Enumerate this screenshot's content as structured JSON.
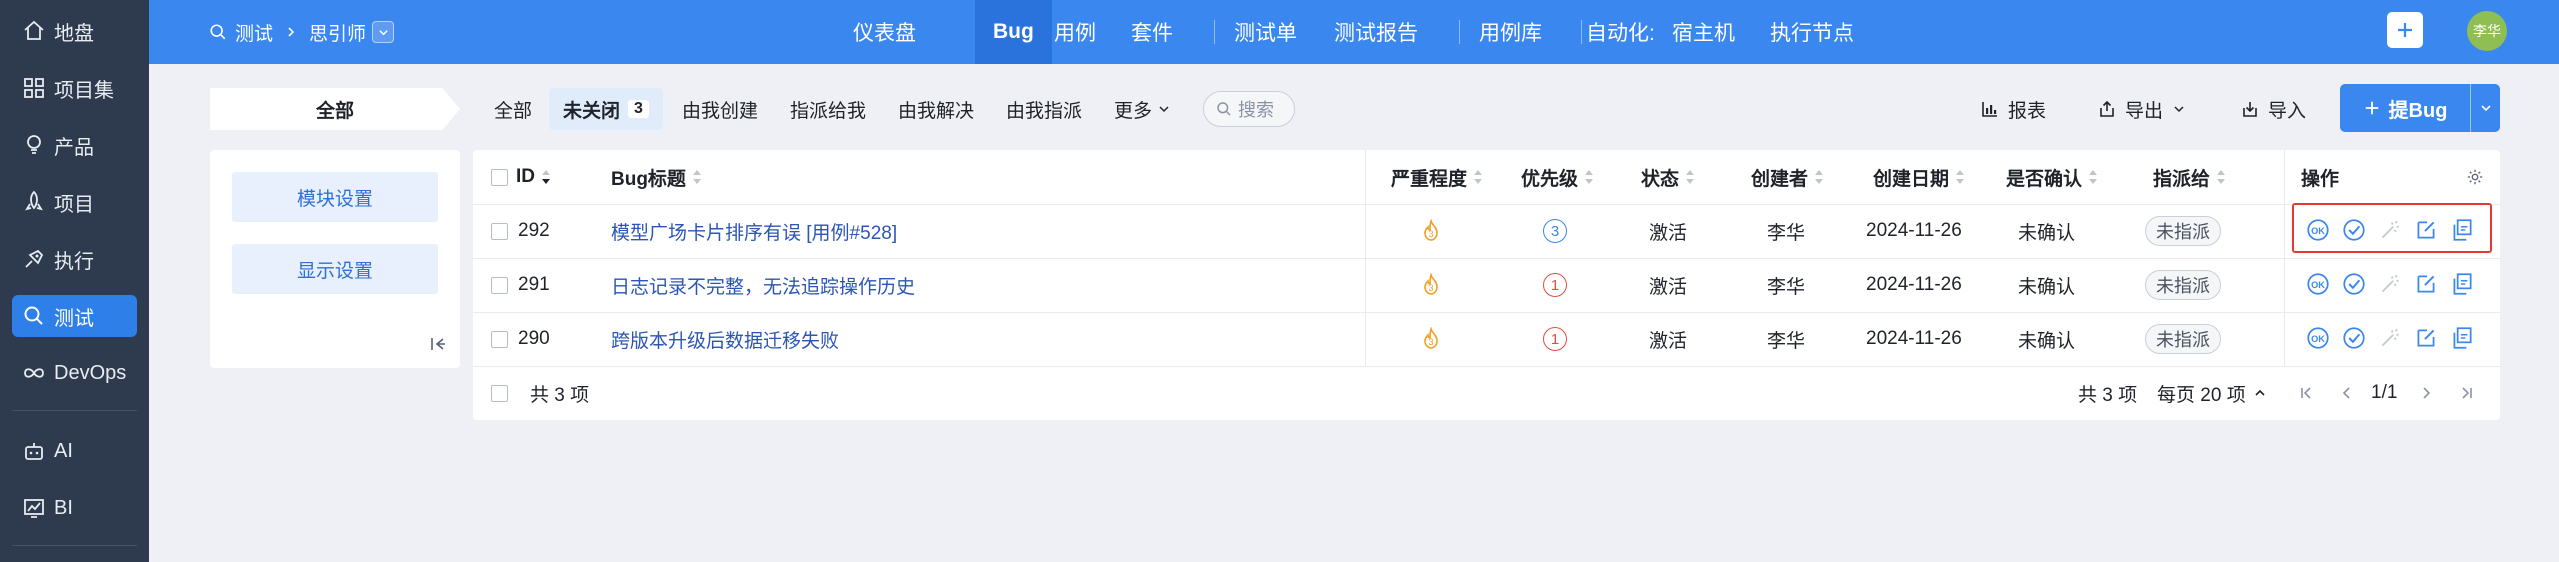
{
  "sidebar": {
    "items": [
      {
        "label": "地盘",
        "icon": "home-icon"
      },
      {
        "label": "项目集",
        "icon": "grid-icon"
      },
      {
        "label": "产品",
        "icon": "bulb-icon"
      },
      {
        "label": "项目",
        "icon": "rocket-icon"
      },
      {
        "label": "执行",
        "icon": "run-icon"
      },
      {
        "label": "测试",
        "icon": "search-icon"
      },
      {
        "label": "DevOps",
        "icon": "infinity-icon"
      },
      {
        "label": "AI",
        "icon": "robot-icon"
      },
      {
        "label": "BI",
        "icon": "chart-icon"
      }
    ],
    "active_index": 5
  },
  "topbar": {
    "breadcrumb": {
      "module": "测试",
      "product": "思引师"
    },
    "nav": [
      {
        "label": "仪表盘"
      },
      {
        "label": "Bug",
        "active": true
      },
      {
        "label": "用例"
      },
      {
        "label": "套件"
      },
      {
        "label": "测试单"
      },
      {
        "label": "测试报告"
      },
      {
        "label": "用例库"
      },
      {
        "label": "自动化:"
      },
      {
        "label": "宿主机"
      },
      {
        "label": "执行节点"
      }
    ],
    "avatar": "李华"
  },
  "filterbar": {
    "scope": "全部",
    "tabs": [
      {
        "label": "全部"
      },
      {
        "label": "未关闭",
        "count": "3",
        "active": true
      },
      {
        "label": "由我创建"
      },
      {
        "label": "指派给我"
      },
      {
        "label": "由我解决"
      },
      {
        "label": "由我指派"
      },
      {
        "label": "更多"
      }
    ],
    "search_label": "搜索",
    "tools": {
      "report": "报表",
      "export": "导出",
      "import": "导入"
    },
    "create_bug": "提Bug"
  },
  "module_panel": {
    "module_settings": "模块设置",
    "display_settings": "显示设置"
  },
  "table": {
    "headers": {
      "id": "ID",
      "title": "Bug标题",
      "severity": "严重程度",
      "priority": "优先级",
      "status": "状态",
      "creator": "创建者",
      "created": "创建日期",
      "confirmed": "是否确认",
      "assignee": "指派给",
      "actions": "操作"
    },
    "rows": [
      {
        "id": "292",
        "title": "模型广场卡片排序有误 [用例#528]",
        "priority": "3",
        "priority_color": "#3a87f0",
        "status": "激活",
        "creator": "李华",
        "created": "2024-11-26",
        "confirmed": "未确认",
        "assignee": "未指派"
      },
      {
        "id": "291",
        "title": "日志记录不完整，无法追踪操作历史",
        "priority": "1",
        "priority_color": "#e84c3d",
        "status": "激活",
        "creator": "李华",
        "created": "2024-11-26",
        "confirmed": "未确认",
        "assignee": "未指派"
      },
      {
        "id": "290",
        "title": "跨版本升级后数据迁移失败",
        "priority": "1",
        "priority_color": "#e84c3d",
        "status": "激活",
        "creator": "李华",
        "created": "2024-11-26",
        "confirmed": "未确认",
        "assignee": "未指派"
      }
    ],
    "footer": {
      "selected_total": "共 3 项",
      "total": "共 3 项",
      "per_page": "每页 20 项",
      "page": "1/1"
    }
  },
  "colors": {
    "primary": "#3a87f0",
    "sidebar_bg": "#2e3a4d",
    "severity_icon": "#f0a020",
    "highlight": "#e53935"
  }
}
